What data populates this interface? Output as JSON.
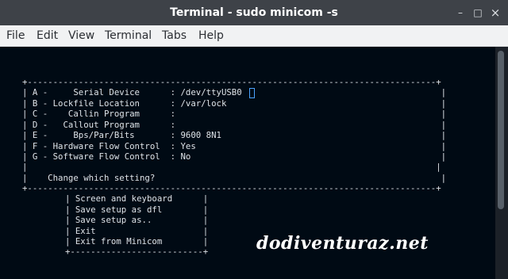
{
  "window": {
    "title": "Terminal - sudo minicom -s",
    "controls": {
      "minimize": "–",
      "maximize": "□",
      "close": "×"
    }
  },
  "menu": [
    "File",
    "Edit",
    "View",
    "Terminal",
    "Tabs",
    "Help"
  ],
  "config_box": {
    "top_border": "+--------------------------------------------------------------------------------+",
    "rows": [
      "| A -     Serial Device      : /dev/ttyUSB0                                       |",
      "| B - Lockfile Location      : /var/lock                                          |",
      "| C -    Callin Program      :                                                    |",
      "| D -   Callout Program      :                                                    |",
      "| E -     Bps/Par/Bits       : 9600 8N1                                           |",
      "| F - Hardware Flow Control  : Yes                                                |",
      "| G - Software Flow Control  : No                                                 |",
      "|                                                                                |",
      "|    Change which setting?                                                        |"
    ],
    "bottom_border": "+--------------------------------------------------------------------------------+"
  },
  "menu_box": {
    "rows": [
      "| Screen and keyboard      |",
      "| Save setup as dfl        |",
      "| Save setup as..          |",
      "| Exit                     |",
      "| Exit from Minicom        |"
    ],
    "bottom_border": "+--------------------------+"
  },
  "watermark": "dodiventuraz.net",
  "colors": {
    "titlebar": "#3e4248",
    "menubar": "#f1f2f3",
    "terminal_bg": "#000a14",
    "terminal_fg": "#dfe3e8",
    "cursor": "#4aa3ff"
  }
}
